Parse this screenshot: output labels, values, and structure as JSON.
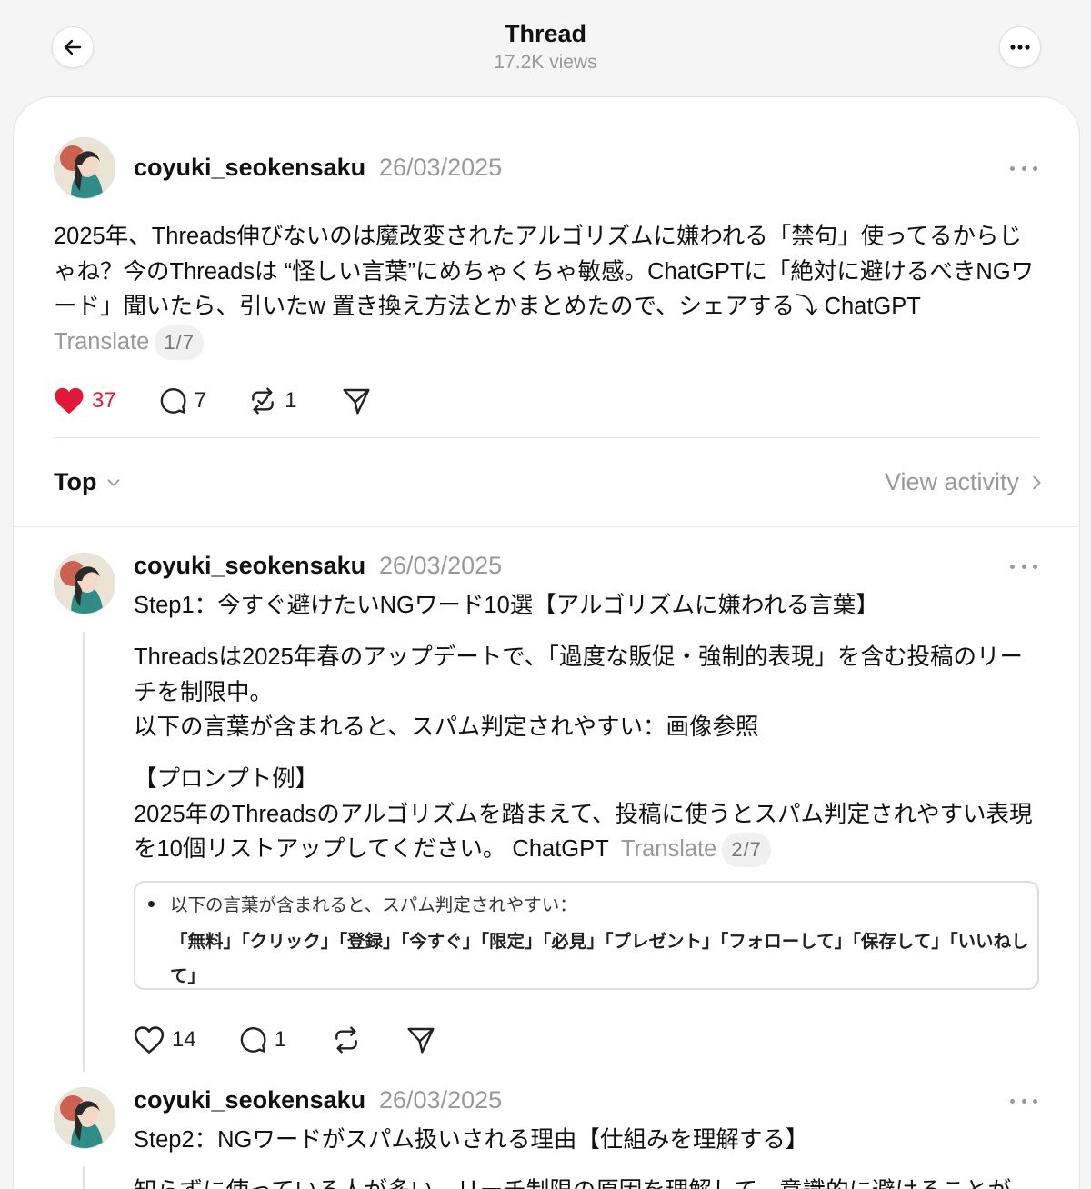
{
  "header": {
    "title": "Thread",
    "views": "17.2K views"
  },
  "main_post": {
    "username": "coyuki_seokensaku",
    "date": "26/03/2025",
    "text": "2025年、Threads伸びないのは魔改変されたアルゴリズムに嫌われる「禁句」使ってるからじゃね？今のThreadsは “怪しい言葉”にめちゃくちゃ敏感。ChatGPTに「絶対に避けるべきNGワード」聞いたら、引いたw 置き換え方法とかまとめたので、シェアする⤵︎ ChatGPT",
    "translate": "Translate",
    "page": "1/7",
    "likes": "37",
    "replies": "7",
    "reposts": "1"
  },
  "sort": {
    "label": "Top",
    "view_activity": "View activity"
  },
  "reply1": {
    "username": "coyuki_seokensaku",
    "date": "26/03/2025",
    "title_line": "Step1：今すぐ避けたいNGワード10選【アルゴリズムに嫌われる言葉】",
    "para1": "Threadsは2025年春のアップデートで、「過度な販促・強制的表現」を含む投稿のリーチを制限中。\n以下の言葉が含まれると、スパム判定されやすい：画像参照",
    "para2": "【プロンプト例】\n2025年のThreadsのアルゴリズムを踏まえて、投稿に使うとスパム判定されやすい表現を10個リストアップしてください。 ChatGPT",
    "translate": "Translate",
    "page": "2/7",
    "quote_line1": "以下の言葉が含まれると、スパム判定されやすい：",
    "quote_line2": "「無料」「クリック」「登録」「今すぐ」「限定」「必見」「プレゼント」「フォローして」「保存して」「いいねして」",
    "likes": "14",
    "replies": "1"
  },
  "reply2": {
    "username": "coyuki_seokensaku",
    "date": "26/03/2025",
    "title_line": "Step2：NGワードがスパム扱いされる理由【仕組みを理解する】",
    "para1": "知らずに使っている人が多い。リーチ制限の原因を理解して、意識的に避けることが"
  },
  "icons": {
    "back": "arrow-left-icon",
    "more": "ellipsis-icon",
    "like": "heart-icon",
    "reply": "speech-bubble-icon",
    "repost": "repost-icon",
    "share": "paper-plane-icon"
  },
  "colors": {
    "liked": "#e0193a",
    "muted": "#999999"
  }
}
